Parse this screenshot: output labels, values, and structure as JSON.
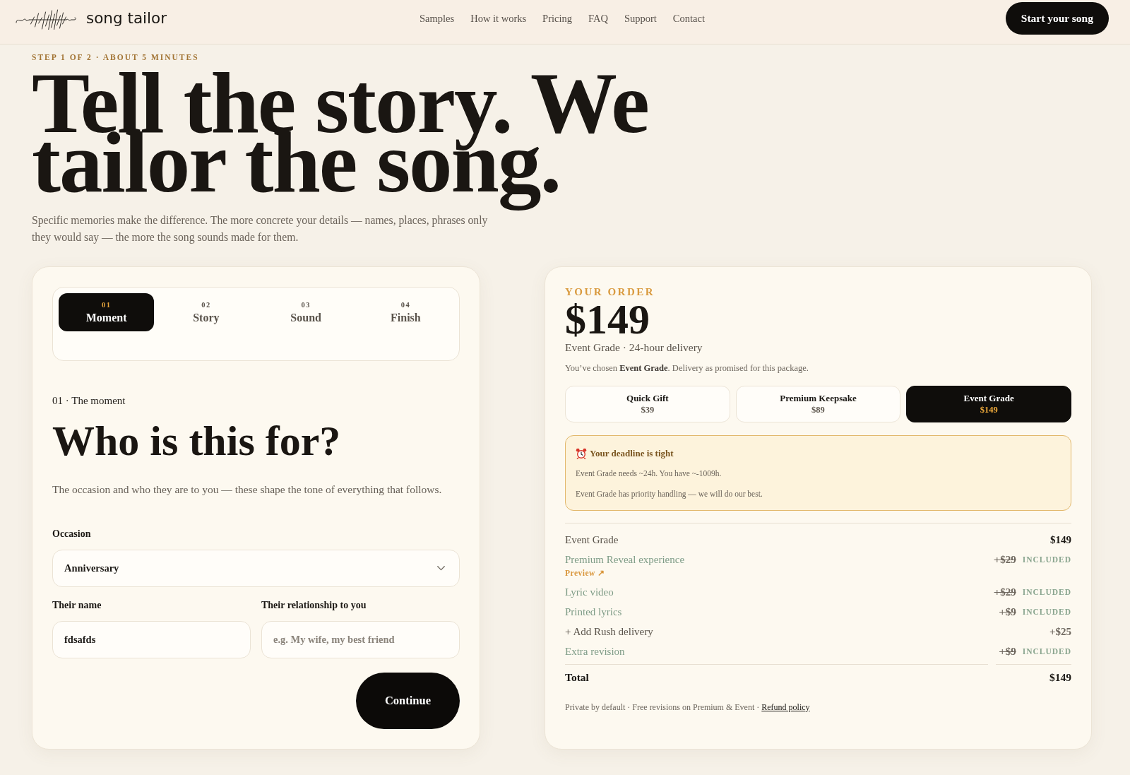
{
  "header": {
    "logo_text": "song tailor",
    "nav": [
      "Samples",
      "How it works",
      "Pricing",
      "FAQ",
      "Support",
      "Contact"
    ],
    "cta": "Start your song"
  },
  "hero": {
    "eyebrow": "STEP 1 OF 2 · ABOUT 5 MINUTES",
    "title": "Tell the story. We tailor the song.",
    "subtitle": "Specific memories make the difference. The more concrete your details — names, places, phrases only they would say — the more the song sounds made for them."
  },
  "form_card": {
    "steps": [
      {
        "number": "01",
        "label": "Moment",
        "selected": true
      },
      {
        "number": "02",
        "label": "Story",
        "selected": false
      },
      {
        "number": "03",
        "label": "Sound",
        "selected": false
      },
      {
        "number": "04",
        "label": "Finish",
        "selected": false
      }
    ],
    "section_label": "01 · The moment",
    "heading": "Who is this for?",
    "description": "The occasion and who they are to you — these shape the tone of everything that follows.",
    "fields": [
      {
        "kind": "select",
        "label": "Occasion",
        "value": "Anniversary"
      },
      {
        "kind": "text",
        "label": "Their name",
        "value": "fdsafds"
      },
      {
        "kind": "text",
        "label": "Their relationship to you",
        "placeholder": "e.g. My wife, my best friend"
      }
    ],
    "continue_button": "Continue"
  },
  "order_card": {
    "eyebrow": "YOUR ORDER",
    "price": "$149",
    "summary": "Event Grade · 24-hour delivery",
    "note": "You’ve chosen **Event Grade**. Delivery as promised for this package.",
    "packages": [
      {
        "name": "Quick Gift",
        "price": "$39",
        "selected": false
      },
      {
        "name": "Premium Keepsake",
        "price": "$89",
        "selected": false
      },
      {
        "name": "Event Grade",
        "price": "$149",
        "selected": true
      }
    ],
    "alert": {
      "title": "Your deadline is tight",
      "lines": [
        "Event Grade needs ~24h. You have ~-1009h.",
        "Event Grade has priority handling — we will do our best."
      ]
    },
    "line_items": [
      {
        "kind": "package",
        "name": "Event Grade",
        "price": "$149"
      },
      {
        "kind": "included",
        "name": "Premium Reveal experience",
        "link": "Preview ↗",
        "price": "+$29",
        "badge": "INCLUDED"
      },
      {
        "kind": "included",
        "name": "Lyric video",
        "price": "+$29",
        "badge": "INCLUDED"
      },
      {
        "kind": "included",
        "name": "Printed lyrics",
        "price": "+$9",
        "badge": "INCLUDED"
      },
      {
        "kind": "addon",
        "name": "+ Add Rush delivery",
        "price": "+$25"
      },
      {
        "kind": "included",
        "name": "Extra revision",
        "price": "+$9",
        "badge": "INCLUDED"
      }
    ],
    "total": {
      "label": "Total",
      "value": "$149"
    },
    "footer": {
      "text": "Private by default · Free revisions on Premium & Event ·",
      "link": "Refund policy"
    }
  }
}
